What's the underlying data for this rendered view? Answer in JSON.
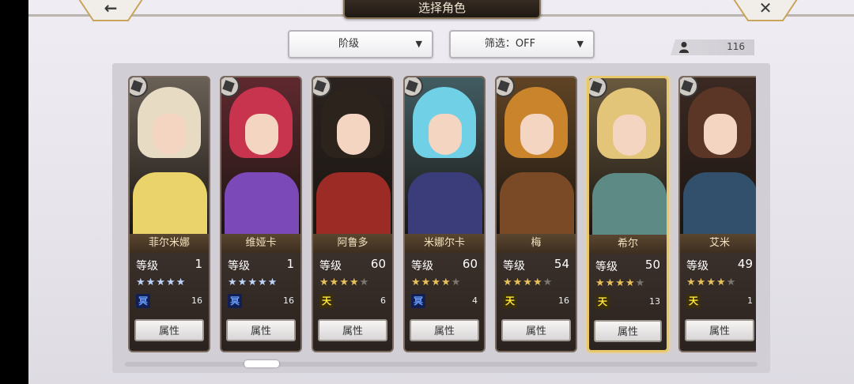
{
  "header": {
    "title": "选择角色",
    "back_glyph": "←",
    "close_glyph": "✕"
  },
  "filters": {
    "sort_label": "阶级",
    "filter_label": "筛选：OFF",
    "arrow": "▼"
  },
  "roster_count": "116",
  "icons": {
    "back": "left-arrow-icon",
    "close": "close-icon",
    "person": "person-icon",
    "badge": "class-badge-icon",
    "dropdown": "chevron-down-icon"
  },
  "colors": {
    "selected_border": "#e8c86a",
    "blue_rank": "#6aa0ff",
    "gold_rank": "#ffe53a",
    "star_gold": "#e7c05a",
    "star_blue": "#bcd3f7"
  },
  "characters": [
    {
      "name": "菲尔米娜",
      "level_label": "等级",
      "level": "1",
      "stars": 5,
      "max_stars": 5,
      "star_type": "blue",
      "rank": "冥",
      "rank_type": "blue",
      "count": "16",
      "attr_label": "属性",
      "hair": "#e7dbc4",
      "outfit": "#e9d36a",
      "selected": false
    },
    {
      "name": "维娅卡",
      "level_label": "等级",
      "level": "1",
      "stars": 5,
      "max_stars": 5,
      "star_type": "blue",
      "rank": "冥",
      "rank_type": "blue",
      "count": "16",
      "attr_label": "属性",
      "hair": "#c8344e",
      "outfit": "#7b4ab8",
      "selected": false
    },
    {
      "name": "阿鲁多",
      "level_label": "等级",
      "level": "60",
      "stars": 4,
      "max_stars": 5,
      "star_type": "gold",
      "rank": "天",
      "rank_type": "gold",
      "count": "6",
      "attr_label": "属性",
      "hair": "#2d231d",
      "outfit": "#9b2b24",
      "selected": false
    },
    {
      "name": "米娜尔卡",
      "level_label": "等级",
      "level": "60",
      "stars": 4,
      "max_stars": 5,
      "star_type": "gold",
      "rank": "冥",
      "rank_type": "blue",
      "count": "4",
      "attr_label": "属性",
      "hair": "#6fd0e6",
      "outfit": "#3a3d7a",
      "selected": false
    },
    {
      "name": "梅",
      "level_label": "等级",
      "level": "54",
      "stars": 4,
      "max_stars": 5,
      "star_type": "gold",
      "rank": "天",
      "rank_type": "gold",
      "count": "16",
      "attr_label": "属性",
      "hair": "#c9842c",
      "outfit": "#7a4a26",
      "selected": false
    },
    {
      "name": "希尔",
      "level_label": "等级",
      "level": "50",
      "stars": 4,
      "max_stars": 5,
      "star_type": "gold",
      "rank": "天",
      "rank_type": "gold",
      "count": "13",
      "attr_label": "属性",
      "hair": "#e3c57a",
      "outfit": "#5e8a86",
      "selected": true
    },
    {
      "name": "艾米",
      "level_label": "等级",
      "level": "49",
      "stars": 4,
      "max_stars": 5,
      "star_type": "gold",
      "rank": "天",
      "rank_type": "gold",
      "count": "1",
      "attr_label": "属性",
      "hair": "#5b3626",
      "outfit": "#32506b",
      "selected": false
    }
  ],
  "scroll": {
    "position": 0.2
  }
}
